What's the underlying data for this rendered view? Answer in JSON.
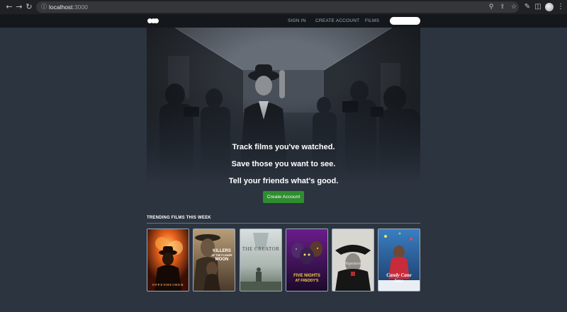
{
  "browser": {
    "url_host": "localhost",
    "url_port": ":3000",
    "icons": [
      "back-arrow-icon",
      "forward-arrow-icon",
      "reload-icon",
      "site-info-icon",
      "zoom-icon",
      "share-icon",
      "bookmark-star-icon",
      "extensions-icon",
      "side-panel-icon",
      "profile-avatar",
      "kebab-menu-icon"
    ]
  },
  "header": {
    "logo": "three-dots-logo",
    "nav": [
      "SIGN IN",
      "CREATE ACCOUNT",
      "FILMS"
    ],
    "search_placeholder": ""
  },
  "hero": {
    "lines": [
      "Track films you've watched.",
      "Save those you want to see.",
      "Tell your friends what's good."
    ],
    "cta_label": "Create Account"
  },
  "trending": {
    "title": "TRENDING FILMS THIS WEEK",
    "posters": [
      {
        "title": "OPPENHEIMER"
      },
      {
        "title_lines": [
          "KILLERS",
          "OF THE FLOWER",
          "MOON"
        ]
      },
      {
        "title": "THE CREATOR"
      },
      {
        "title_lines": [
          "FIVE NIGHTS",
          "AT FREDDY'S"
        ]
      },
      {
        "title": "Napoleon"
      },
      {
        "title_lines": [
          "Candy Cane",
          "lane"
        ]
      }
    ]
  },
  "colors": {
    "page_bg": "#2c3440",
    "header_bg": "#14181c",
    "nav_text": "#99aabb",
    "cta_green": "#2f8d2f"
  }
}
